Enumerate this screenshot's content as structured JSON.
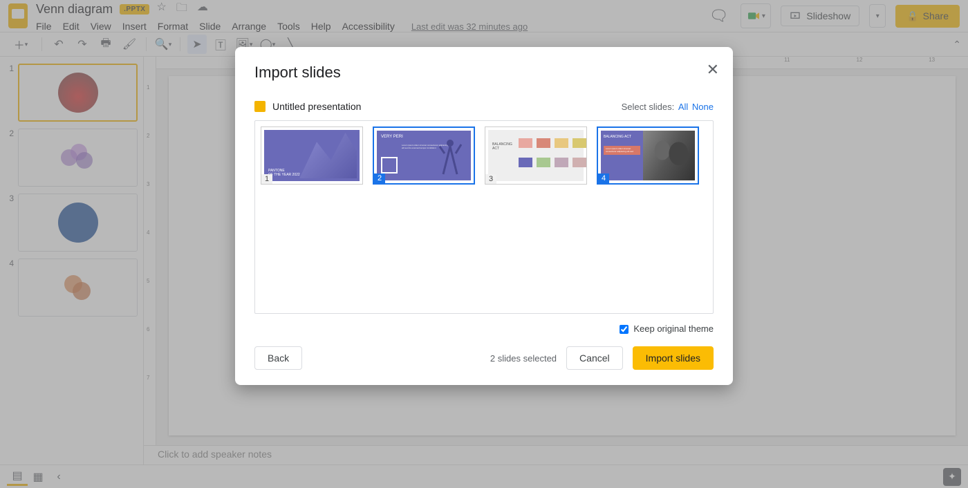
{
  "doc": {
    "title": "Venn diagram",
    "badge": ".PPTX",
    "last_edit": "Last edit was 32 minutes ago"
  },
  "menus": [
    "File",
    "Edit",
    "View",
    "Insert",
    "Format",
    "Slide",
    "Arrange",
    "Tools",
    "Help",
    "Accessibility"
  ],
  "header_buttons": {
    "slideshow": "Slideshow",
    "share": "Share"
  },
  "slides": [
    {
      "num": "1"
    },
    {
      "num": "2"
    },
    {
      "num": "3"
    },
    {
      "num": "4"
    }
  ],
  "notes_placeholder": "Click to add speaker notes",
  "ruler_h": [
    "11",
    "12",
    "13"
  ],
  "ruler_v": [
    "1",
    "2",
    "3",
    "4",
    "5",
    "6",
    "7"
  ],
  "modal": {
    "title": "Import slides",
    "source": "Untitled presentation",
    "select_label": "Select slides:",
    "all": "All",
    "none": "None",
    "thumbs": [
      {
        "num": "1",
        "selected": false
      },
      {
        "num": "2",
        "selected": true
      },
      {
        "num": "3",
        "selected": false
      },
      {
        "num": "4",
        "selected": true
      }
    ],
    "keep_theme": "Keep original theme",
    "keep_theme_checked": true,
    "back": "Back",
    "status": "2 slides selected",
    "cancel": "Cancel",
    "import": "Import slides"
  }
}
